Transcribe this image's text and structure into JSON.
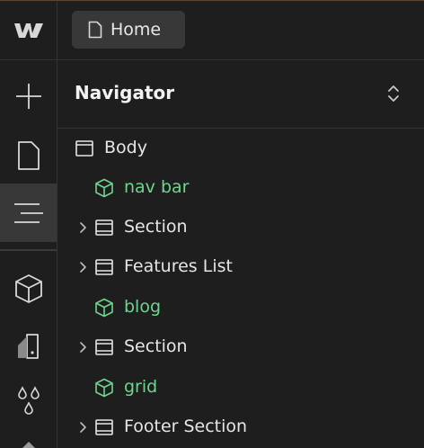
{
  "topbar": {
    "page_button_label": "Home"
  },
  "navigator": {
    "title": "Navigator",
    "items": [
      {
        "label": "Body",
        "kind": "body",
        "depth": 0,
        "expandable": false,
        "color": "#e6e6e6"
      },
      {
        "label": "nav bar",
        "kind": "component",
        "depth": 1,
        "expandable": false,
        "color": "#6fd58e"
      },
      {
        "label": "Section",
        "kind": "section",
        "depth": 1,
        "expandable": true,
        "color": "#e6e6e6"
      },
      {
        "label": "Features List",
        "kind": "section",
        "depth": 1,
        "expandable": true,
        "color": "#e6e6e6"
      },
      {
        "label": "blog",
        "kind": "component",
        "depth": 1,
        "expandable": false,
        "color": "#6fd58e"
      },
      {
        "label": "Section",
        "kind": "section",
        "depth": 1,
        "expandable": true,
        "color": "#e6e6e6"
      },
      {
        "label": "grid",
        "kind": "component",
        "depth": 1,
        "expandable": false,
        "color": "#6fd58e"
      },
      {
        "label": "Footer Section",
        "kind": "section",
        "depth": 1,
        "expandable": true,
        "color": "#e6e6e6"
      }
    ]
  },
  "rail": {
    "items": [
      {
        "icon": "plus-icon",
        "active": false
      },
      {
        "icon": "page-icon",
        "active": false
      },
      {
        "icon": "navigator-icon",
        "active": true
      },
      {
        "icon": "components-icon",
        "active": false
      },
      {
        "icon": "assets-icon",
        "active": false
      },
      {
        "icon": "drops-icon",
        "active": false
      }
    ]
  },
  "colors": {
    "accent_green": "#6fd58e",
    "background": "#1e1e1e",
    "active_bg": "#383838"
  }
}
